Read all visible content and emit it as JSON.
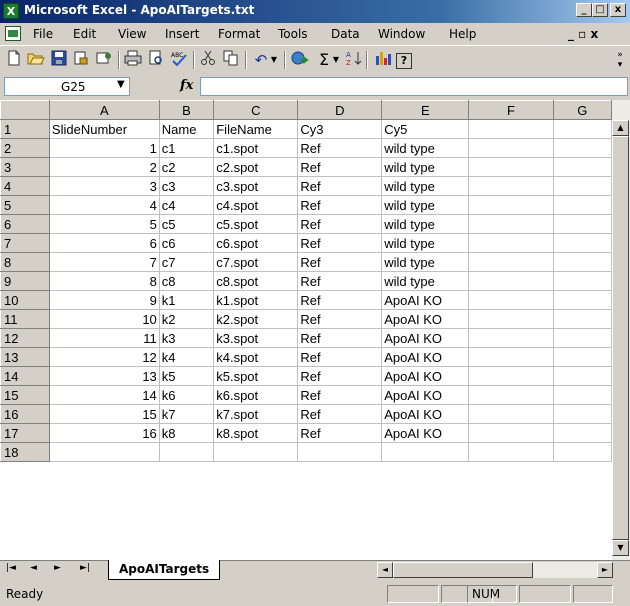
{
  "window": {
    "title": "Microsoft Excel - ApoAITargets.txt",
    "app_icon": "X",
    "min_btn": "_",
    "max_btn": "□",
    "close_btn": "x"
  },
  "menubar": {
    "items": [
      "File",
      "Edit",
      "View",
      "Insert",
      "Format",
      "Tools",
      "Data",
      "Window",
      "Help"
    ],
    "restore_glyph": "_ ▫ x"
  },
  "toolbar": {
    "icons": [
      "new-icon",
      "open-icon",
      "save-icon",
      "permission-icon",
      "email-icon",
      "print-icon",
      "print-preview-icon",
      "spelling-icon",
      "cut-icon",
      "copy-icon",
      "undo-icon",
      "undo-dropdown-icon",
      "hyperlink-icon",
      "autosum-icon",
      "autosum-dropdown-icon",
      "sort-ascending-icon",
      "chart-wizard-icon",
      "help-icon",
      "toolbar-options-icon"
    ],
    "autosum_glyph": "Σ",
    "undo_glyph": "↶",
    "help_glyph": "?"
  },
  "formula_bar": {
    "name_box": "G25",
    "fx_label": "fx",
    "value": ""
  },
  "columns": [
    "A",
    "B",
    "C",
    "D",
    "E",
    "F",
    "G"
  ],
  "rows": [
    {
      "n": "1",
      "A": "SlideNumber",
      "B": "Name",
      "C": "FileName",
      "D": "Cy3",
      "E": "Cy5"
    },
    {
      "n": "2",
      "A": "1",
      "B": "c1",
      "C": "c1.spot",
      "D": "Ref",
      "E": "wild type"
    },
    {
      "n": "3",
      "A": "2",
      "B": "c2",
      "C": "c2.spot",
      "D": "Ref",
      "E": "wild type"
    },
    {
      "n": "4",
      "A": "3",
      "B": "c3",
      "C": "c3.spot",
      "D": "Ref",
      "E": "wild type"
    },
    {
      "n": "5",
      "A": "4",
      "B": "c4",
      "C": "c4.spot",
      "D": "Ref",
      "E": "wild type"
    },
    {
      "n": "6",
      "A": "5",
      "B": "c5",
      "C": "c5.spot",
      "D": "Ref",
      "E": "wild type"
    },
    {
      "n": "7",
      "A": "6",
      "B": "c6",
      "C": "c6.spot",
      "D": "Ref",
      "E": "wild type"
    },
    {
      "n": "8",
      "A": "7",
      "B": "c7",
      "C": "c7.spot",
      "D": "Ref",
      "E": "wild type"
    },
    {
      "n": "9",
      "A": "8",
      "B": "c8",
      "C": "c8.spot",
      "D": "Ref",
      "E": "wild type"
    },
    {
      "n": "10",
      "A": "9",
      "B": "k1",
      "C": "k1.spot",
      "D": "Ref",
      "E": "ApoAI KO"
    },
    {
      "n": "11",
      "A": "10",
      "B": "k2",
      "C": "k2.spot",
      "D": "Ref",
      "E": "ApoAI KO"
    },
    {
      "n": "12",
      "A": "11",
      "B": "k3",
      "C": "k3.spot",
      "D": "Ref",
      "E": "ApoAI KO"
    },
    {
      "n": "13",
      "A": "12",
      "B": "k4",
      "C": "k4.spot",
      "D": "Ref",
      "E": "ApoAI KO"
    },
    {
      "n": "14",
      "A": "13",
      "B": "k5",
      "C": "k5.spot",
      "D": "Ref",
      "E": "ApoAI KO"
    },
    {
      "n": "15",
      "A": "14",
      "B": "k6",
      "C": "k6.spot",
      "D": "Ref",
      "E": "ApoAI KO"
    },
    {
      "n": "16",
      "A": "15",
      "B": "k7",
      "C": "k7.spot",
      "D": "Ref",
      "E": "ApoAI KO"
    },
    {
      "n": "17",
      "A": "16",
      "B": "k8",
      "C": "k8.spot",
      "D": "Ref",
      "E": "ApoAI KO"
    },
    {
      "n": "18",
      "A": "",
      "B": "",
      "C": "",
      "D": "",
      "E": ""
    }
  ],
  "sheet_tabs": {
    "active": "ApoAITargets",
    "nav": [
      "|◄",
      "◄",
      "►",
      "►|"
    ]
  },
  "status": {
    "left": "Ready",
    "num": "NUM"
  },
  "colors": {
    "title_start": "#0a246a",
    "title_end": "#a6caf0",
    "chrome": "#d4d0c8",
    "grid_line": "#c0c0c0",
    "excel_green": "#1e7a2e"
  }
}
